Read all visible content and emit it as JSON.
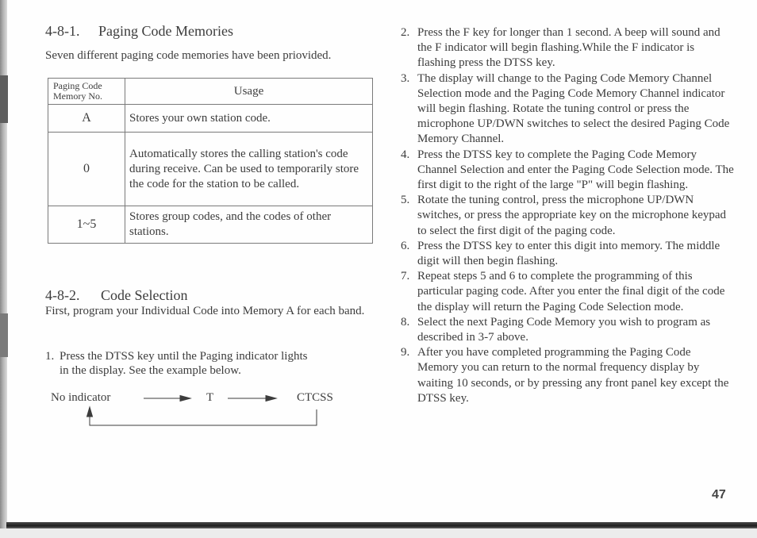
{
  "left": {
    "section1": {
      "number": "4-8-1.",
      "title": "Paging Code Memories",
      "intro": "Seven different  paging code memories have been priovided."
    },
    "table": {
      "headers": {
        "col1_line1": "Paging Code",
        "col1_line2": "Memory No.",
        "col2": "Usage"
      },
      "rows": [
        {
          "memory": "A",
          "usage": "Stores your own station code."
        },
        {
          "memory": "0",
          "usage": "Automatically stores the calling station's code during receive. Can be used to temporarily store the code for the station to be called."
        },
        {
          "memory": "1~5",
          "usage": "Stores group codes, and the codes of other stations."
        }
      ]
    },
    "section2": {
      "number": "4-8-2.",
      "title": "Code Selection",
      "intro": "First, program your Individual Code into Memory A for each band."
    },
    "step1": {
      "number": "1.",
      "line1": "Press the DTSS key until the Paging indicator lights",
      "line2": "in the display. See the example below."
    },
    "flow": {
      "states": [
        "No indicator",
        "T",
        "CTCSS"
      ]
    }
  },
  "right": {
    "steps": [
      {
        "number": "2.",
        "text": "Press the F key for longer than 1 second. A beep will sound and the F indicator will begin flashing.While the F indicator is flashing press the DTSS key."
      },
      {
        "number": "3.",
        "text": "The display will change to the Paging Code Memory Channel Selection mode and the Paging Code Memory Channel indicator will begin flashing. Rotate the tuning control or press the microphone UP/DWN switches to select the desired Paging Code Memory Channel."
      },
      {
        "number": "4.",
        "text": "Press the DTSS key to complete the Paging Code Memory Channel Selection and enter the Paging Code Selection mode. The first digit to the right of the large \"P\" will begin flashing."
      },
      {
        "number": "5.",
        "text": "Rotate the tuning control, press the microphone UP/DWN switches, or press the appropriate key on the microphone keypad to select the first digit of the paging code."
      },
      {
        "number": "6.",
        "text": "Press the DTSS key to enter this digit into memory. The middle digit will then begin flashing."
      },
      {
        "number": "7.",
        "text": "Repeat steps 5 and 6 to complete the programming of this particular paging code. After you enter the final digit of the code the display will return the Paging Code Selection mode."
      },
      {
        "number": "8.",
        "text": "Select the next Paging Code Memory you wish to program as described in 3-7 above."
      },
      {
        "number": "9.",
        "text": "After you have completed programming the Paging Code Memory you can return to the normal frequency display by waiting 10 seconds, or by pressing any front panel key except the DTSS key."
      }
    ]
  },
  "page_number": "47"
}
